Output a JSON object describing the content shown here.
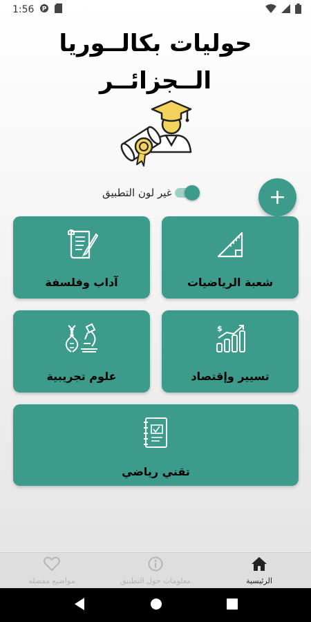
{
  "status_bar": {
    "time": "1:56"
  },
  "header": {
    "title_line1": "حوليات بكالــوريا",
    "title_line2": "الــجزائــر"
  },
  "theme_toggle": {
    "label": "غير لون التطبيق",
    "checked": true
  },
  "fab": {
    "symbol": "+",
    "icon": "plus-icon"
  },
  "cards": [
    {
      "label": "شعبة الرياضيات",
      "icon": "triangle-ruler-icon"
    },
    {
      "label": "آداب وفلسفة",
      "icon": "scroll-pen-icon"
    },
    {
      "label": "تسيير وإقتصاد",
      "icon": "growth-chart-icon"
    },
    {
      "label": "علوم تجريبية",
      "icon": "dna-microscope-icon"
    },
    {
      "label": "تقني رياضي",
      "icon": "notebook-icon"
    }
  ],
  "bottom_nav": [
    {
      "label": "الرئيسية",
      "icon": "home-icon",
      "active": true
    },
    {
      "label": "معلومات حول التطبيق",
      "icon": "info-icon",
      "active": false
    },
    {
      "label": "مواضيع مفضلة",
      "icon": "heart-icon",
      "active": false
    }
  ],
  "colors": {
    "primary": "#3d9b8b",
    "label_text": "#000000",
    "inactive_nav": "#b5b5b5"
  }
}
